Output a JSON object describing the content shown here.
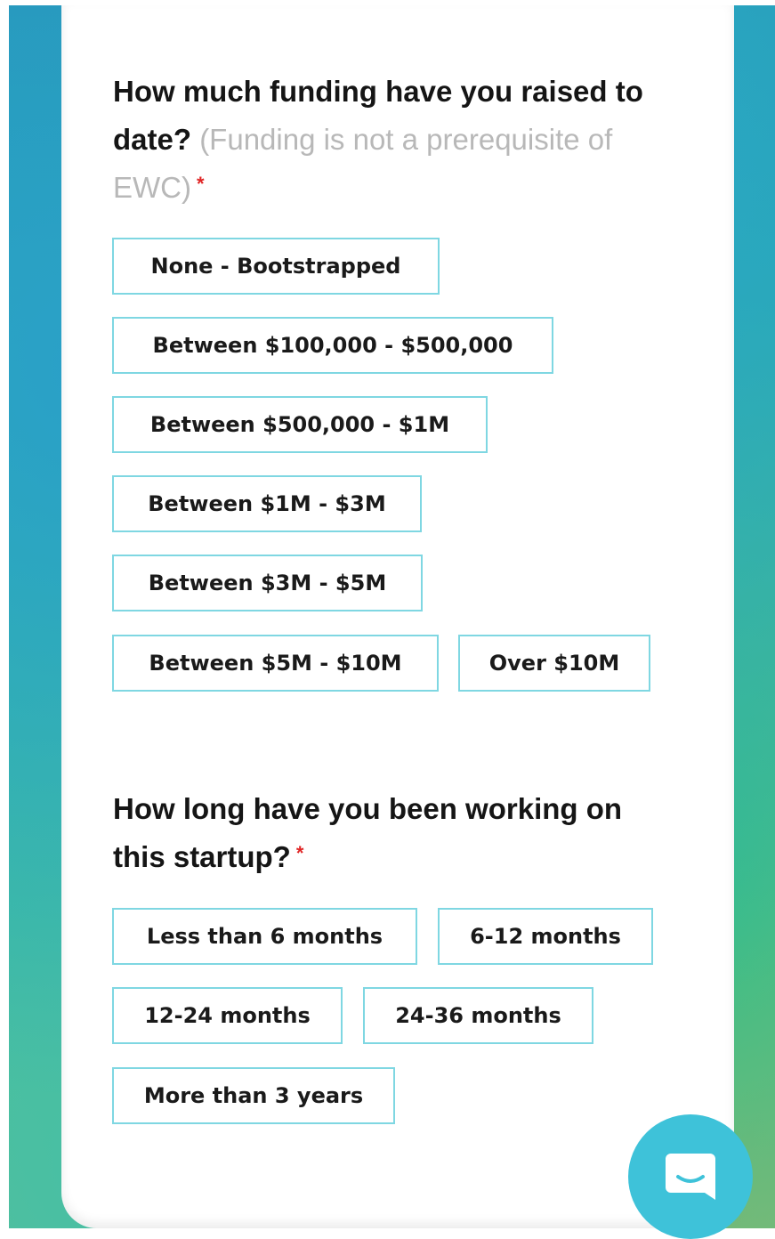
{
  "funding_question": {
    "title": "How much funding have you raised to date?",
    "hint": "(Funding is not a prerequisite of EWC)",
    "required_mark": "*",
    "options": [
      "None - Bootstrapped",
      "Between $100,000 - $500,000",
      "Between $500,000 - $1M",
      "Between $1M - $3M",
      "Between $3M - $5M",
      "Between $5M - $10M",
      "Over $10M"
    ]
  },
  "duration_question": {
    "title": "How long have you been working on this startup?",
    "required_mark": "*",
    "options": [
      "Less than 6 months",
      "6-12 months",
      "12-24 months",
      "24-36 months",
      "More than 3 years"
    ]
  },
  "chat_widget": {
    "icon": "chat-icon",
    "color": "#3ec2d9"
  },
  "colors": {
    "option_border": "#7fd7e2",
    "required": "#e02525",
    "hint": "#b8b8b8"
  }
}
